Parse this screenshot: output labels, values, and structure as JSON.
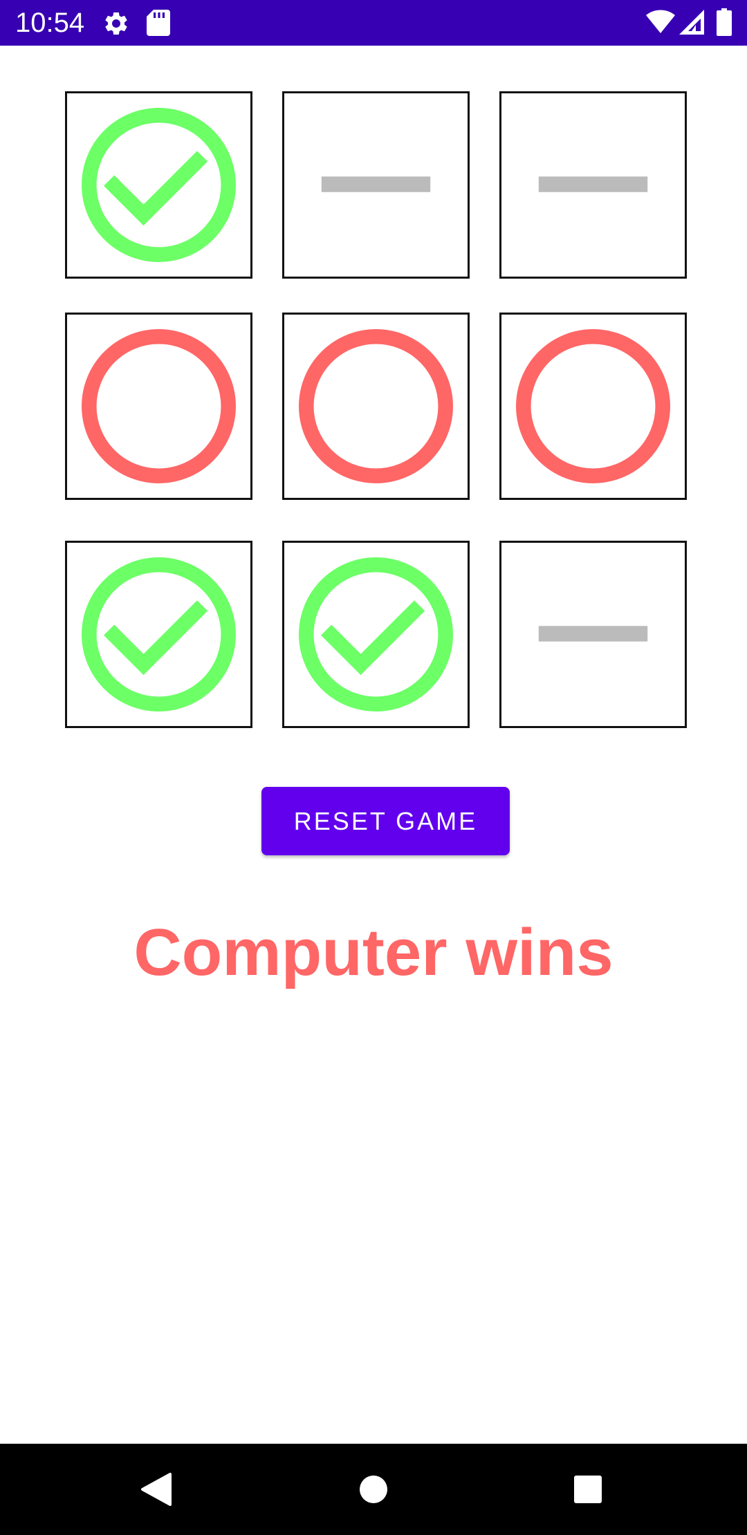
{
  "status_bar": {
    "time": "10:54",
    "icons": [
      "settings-icon",
      "sd-card-icon",
      "wifi-icon",
      "cellular-signal-icon",
      "battery-icon"
    ],
    "background": "#3700b3"
  },
  "board": {
    "cells": [
      {
        "row": 1,
        "col": 1,
        "state": "check"
      },
      {
        "row": 1,
        "col": 2,
        "state": "empty"
      },
      {
        "row": 1,
        "col": 3,
        "state": "empty"
      },
      {
        "row": 2,
        "col": 1,
        "state": "circle"
      },
      {
        "row": 2,
        "col": 2,
        "state": "circle"
      },
      {
        "row": 2,
        "col": 3,
        "state": "circle"
      },
      {
        "row": 3,
        "col": 1,
        "state": "check"
      },
      {
        "row": 3,
        "col": 2,
        "state": "check"
      },
      {
        "row": 3,
        "col": 3,
        "state": "empty"
      }
    ],
    "colors": {
      "check": "#6cff66",
      "circle": "#ff6666",
      "empty": "#bbbbbb",
      "border": "#111111"
    }
  },
  "reset_button": {
    "label": "RESET GAME",
    "color": "#6200ee"
  },
  "result": {
    "text": "Computer wins",
    "color": "#ff6666"
  },
  "nav_bar": {
    "buttons": [
      "back-icon",
      "home-icon",
      "recents-icon"
    ]
  }
}
